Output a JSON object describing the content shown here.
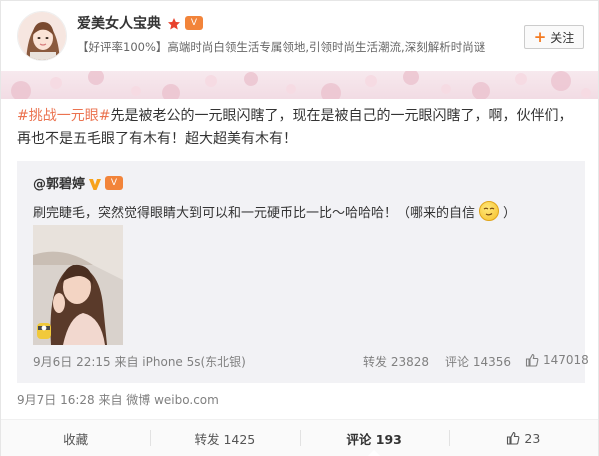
{
  "header": {
    "name": "爱美女人宝典",
    "vip_badge": "V",
    "description_prefix": "【好评率100%】",
    "description": "高端时尚白领生活专属领地,引领时尚生活潮流,深刻解析时尚谜",
    "follow_label": "关注",
    "follow_icon": "plus-icon"
  },
  "post": {
    "topic": "#挑战一元眼#",
    "text_line1": "先是被老公的一元眼闪瞎了，现在是被自己的一元眼闪瞎了，啊，伙伴们，",
    "text_line2": "再也不是五毛眼了有木有！超大超美有木有！",
    "time": "9月7日 16:28 来自 微博 weibo.com"
  },
  "repost": {
    "author": "@郭碧婷",
    "text_before_emoji": "刷完睫毛，突然觉得眼睛大到可以和一元硬币比一比～哈哈哈！（哪来的自信",
    "text_after_emoji": "）",
    "emoji": "smug-face-emoji",
    "time": "9月6日 22:15 来自 iPhone 5s(东北银)",
    "forward_label": "转发 23828",
    "comment_label": "评论 14356",
    "like_count": "147018"
  },
  "actions": {
    "favorite_label": "收藏",
    "forward_label": "转发 1425",
    "comment_label": "评论 193",
    "like_count": "23"
  },
  "colors": {
    "topic": "#eb7350",
    "follow_plus": "#f47a20",
    "repost_bg": "#f2f2f5",
    "meta_text": "#808080"
  }
}
